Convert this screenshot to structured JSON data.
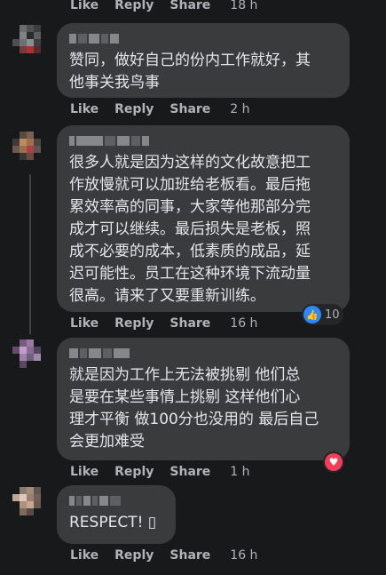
{
  "actions": {
    "like": "Like",
    "reply": "Reply",
    "share": "Share"
  },
  "comments": [
    {
      "timestamp": "18 h"
    },
    {
      "text": "赞同，做好自己的份内工作就好，其\n他事关我鸟事",
      "timestamp": "2 h"
    },
    {
      "text": "很多人就是因为这样的文化故意把工\n作放慢就可以加班给老板看。最后拖\n累效率高的同事，大家等他那部分完\n成才可以继续。最后损失是老板，照\n成不必要的成本，低素质的成品，延\n迟可能性。员工在这种环境下流动量\n很高。请来了又要重新训练。",
      "timestamp": "16 h",
      "reaction_count": "10"
    },
    {
      "text": "就是因为工作上无法被挑剔 他们总\n是要在某些事情上挑剔 这样他们心\n理才平衡 做100分也没用的 最后自己\n会更加难受",
      "timestamp": "1 h"
    },
    {
      "text": "RESPECT! ▯",
      "timestamp": "16 h"
    }
  ],
  "colors": {
    "like_blue": "#2d88ff",
    "love_red": "#f33e58"
  }
}
